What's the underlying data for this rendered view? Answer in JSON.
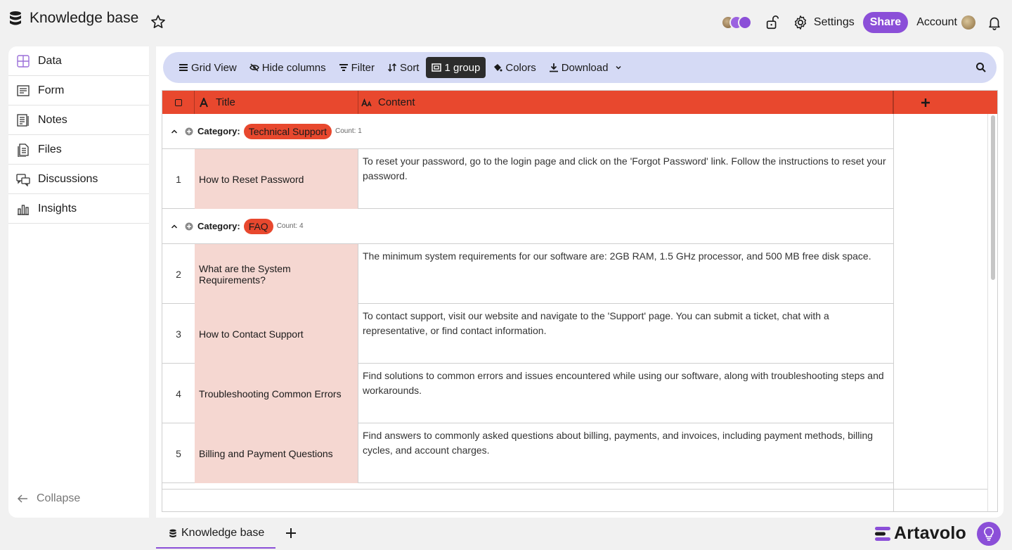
{
  "app": {
    "title": "Knowledge base"
  },
  "topbar": {
    "settings_label": "Settings",
    "share_label": "Share",
    "account_label": "Account"
  },
  "sidebar": {
    "items": [
      {
        "label": "Data",
        "icon": "grid-icon"
      },
      {
        "label": "Form",
        "icon": "form-icon"
      },
      {
        "label": "Notes",
        "icon": "notes-icon"
      },
      {
        "label": "Files",
        "icon": "files-icon"
      },
      {
        "label": "Discussions",
        "icon": "discussions-icon"
      },
      {
        "label": "Insights",
        "icon": "insights-icon"
      }
    ],
    "collapse_label": "Collapse"
  },
  "toolbar": {
    "grid_view": "Grid View",
    "hide_columns": "Hide columns",
    "filter": "Filter",
    "sort": "Sort",
    "group": "1 group",
    "colors": "Colors",
    "download": "Download"
  },
  "table": {
    "columns": {
      "title": "Title",
      "content": "Content"
    },
    "groups": [
      {
        "label": "Category:",
        "value": "Technical Support",
        "count": "Count: 1",
        "rows": [
          {
            "num": "1",
            "title": "How to Reset Password",
            "content": "To reset your password, go to the login page and click on the 'Forgot Password' link. Follow the instructions to reset your password."
          }
        ]
      },
      {
        "label": "Category:",
        "value": "FAQ",
        "count": "Count: 4",
        "rows": [
          {
            "num": "2",
            "title": "What are the System Requirements?",
            "content": "The minimum system requirements for our software are: 2GB RAM, 1.5 GHz processor, and 500 MB free disk space."
          },
          {
            "num": "3",
            "title": "How to Contact Support",
            "content": "To contact support, visit our website and navigate to the 'Support' page. You can submit a ticket, chat with a representative, or find contact information."
          },
          {
            "num": "4",
            "title": "Troubleshooting Common Errors",
            "content": "Find solutions to common errors and issues encountered while using our software, along with troubleshooting steps and workarounds."
          },
          {
            "num": "5",
            "title": "Billing and Payment Questions",
            "content": "Find answers to commonly asked questions about billing, payments, and invoices, including payment methods, billing cycles, and account charges."
          }
        ]
      }
    ]
  },
  "footer": {
    "tab_label": "Knowledge base",
    "brand": "Artavolo"
  },
  "colors": {
    "accent": "#8b4fd8",
    "header": "#e8482e",
    "title_cell": "#f5d7d1",
    "toolbar": "#d5daf5"
  }
}
